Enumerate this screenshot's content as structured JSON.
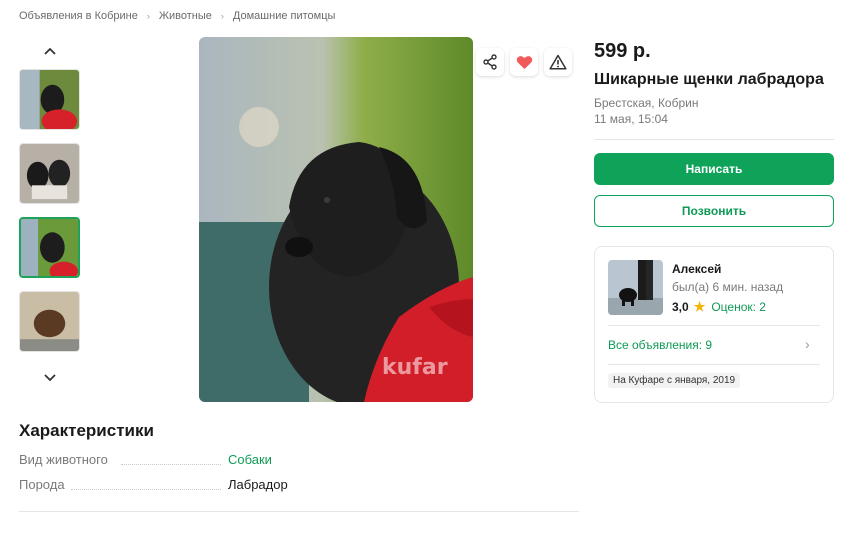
{
  "breadcrumb": [
    "Объявления в Кобрине",
    "Животные",
    "Домашние питомцы"
  ],
  "breadcrumb_separator": "›",
  "gallery": {
    "up_icon": "chevron-up-icon",
    "down_icon": "chevron-down-icon",
    "thumbnails": [
      "puppy-on-red",
      "two-puppies",
      "puppy-on-red-selected",
      "brown-puppy"
    ],
    "selected_index": 2,
    "watermark": "kufar"
  },
  "photo_actions": [
    "share-icon",
    "heart-icon",
    "warning-icon"
  ],
  "listing": {
    "price": "599 р.",
    "title": "Шикарные щенки лабрадора",
    "location": "Брестская, Кобрин",
    "date": "11 мая, 15:04"
  },
  "buttons": {
    "write": "Написать",
    "call": "Позвонить"
  },
  "seller": {
    "name": "Алексей",
    "last_seen": "был(а) 6 мин. назад",
    "rating": "3,0",
    "reviews": "Оценок: 2",
    "all_listings": "Все объявления: 9",
    "since": "На Куфаре с января, 2019"
  },
  "characteristics": {
    "title": "Характеристики",
    "rows": [
      {
        "label": "Вид животного",
        "value": "Собаки"
      },
      {
        "label": "Порода",
        "value": "Лабрадор"
      }
    ]
  },
  "colors": {
    "accent": "#0fa35a",
    "heart": "#f05a5a",
    "star": "#f5b400"
  }
}
